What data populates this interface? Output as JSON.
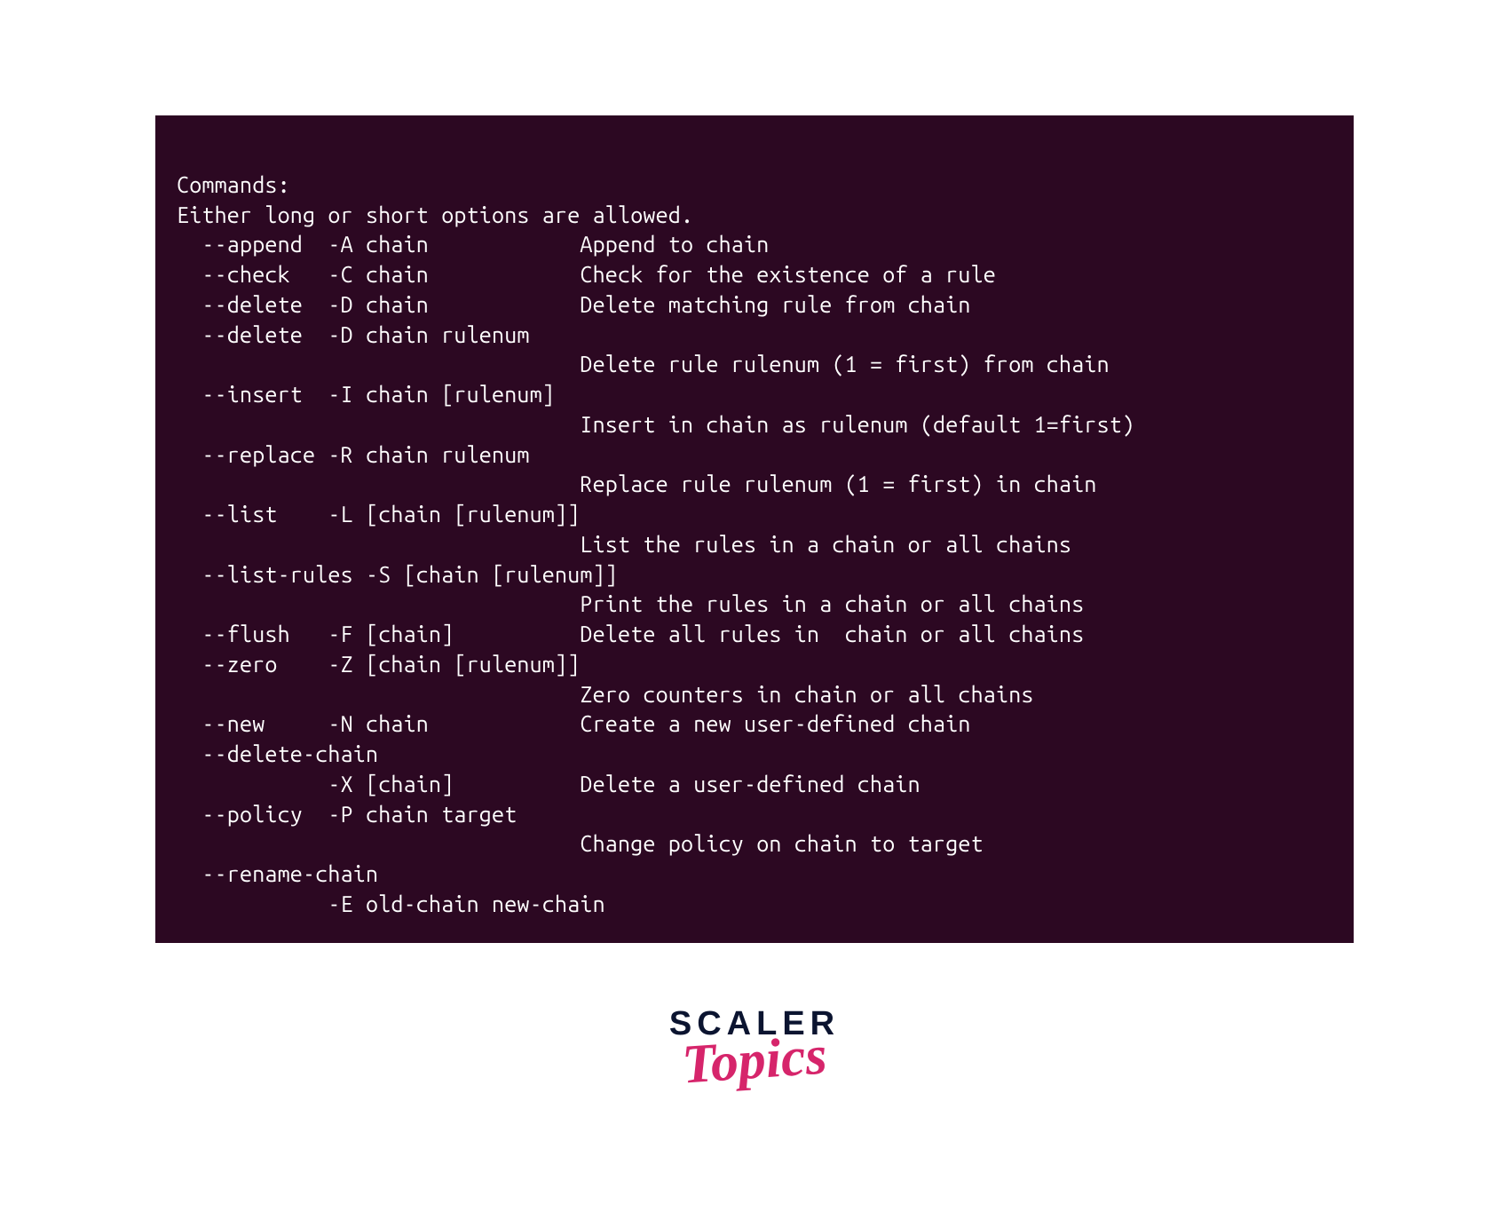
{
  "terminal": {
    "header1": "Commands:",
    "header2": "Either long or short options are allowed.",
    "lines": [
      "  --append  -A chain            Append to chain",
      "  --check   -C chain            Check for the existence of a rule",
      "  --delete  -D chain            Delete matching rule from chain",
      "  --delete  -D chain rulenum",
      "                                Delete rule rulenum (1 = first) from chain",
      "  --insert  -I chain [rulenum]",
      "                                Insert in chain as rulenum (default 1=first)",
      "  --replace -R chain rulenum",
      "                                Replace rule rulenum (1 = first) in chain",
      "  --list    -L [chain [rulenum]]",
      "                                List the rules in a chain or all chains",
      "  --list-rules -S [chain [rulenum]]",
      "                                Print the rules in a chain or all chains",
      "  --flush   -F [chain]          Delete all rules in  chain or all chains",
      "  --zero    -Z [chain [rulenum]]",
      "                                Zero counters in chain or all chains",
      "  --new     -N chain            Create a new user-defined chain",
      "  --delete-chain",
      "            -X [chain]          Delete a user-defined chain",
      "  --policy  -P chain target",
      "                                Change policy on chain to target",
      "  --rename-chain",
      "            -E old-chain new-chain"
    ]
  },
  "logo": {
    "line1": "SCALER",
    "line2": "Topics"
  },
  "colors": {
    "terminal_bg": "#2c0822",
    "terminal_fg": "#ffffff",
    "logo_primary": "#0b1430",
    "logo_accent": "#d6256b"
  }
}
